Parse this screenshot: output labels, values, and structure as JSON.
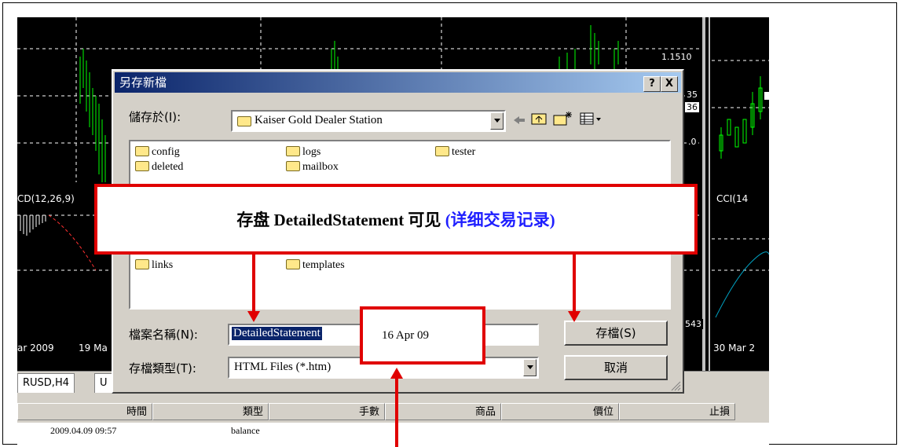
{
  "app": {
    "price_labels": [
      "1.1510",
      "35",
      "36",
      ".0",
      "543"
    ],
    "indicator_left": "CD(12,26,9)",
    "indicator_right": "CCI(14",
    "date_left": "ar 2009",
    "date_left2": "19 Ma",
    "date_right": "30 Mar 2",
    "tabs": [
      "RUSD,H4",
      "U"
    ],
    "columns": [
      "時間",
      "類型",
      "手數",
      "商品",
      "價位",
      "止損"
    ],
    "row": {
      "time": "2009.04.09 09:57",
      "type": "balance"
    }
  },
  "dialog": {
    "title": "另存新檔",
    "help_btn": "?",
    "close_btn": "X",
    "save_in_label": "儲存於(I):",
    "save_in_value": "Kaiser Gold Dealer Station",
    "files": [
      "config",
      "logs",
      "tester",
      "deleted",
      "mailbox",
      "links",
      "templates"
    ],
    "filename_label": "檔案名稱(N):",
    "filename_value": "DetailedStatement",
    "filetype_label": "存檔類型(T):",
    "filetype_value": "HTML Files (*.htm)",
    "save_button": "存檔(S)",
    "cancel_button": "取消"
  },
  "annotation": {
    "main_text": "存盘 DetailedStatement  可见 ",
    "main_text_blue": "(详细交易记录)",
    "date_text": "16 Apr 09",
    "accent_color": "#e00000"
  }
}
